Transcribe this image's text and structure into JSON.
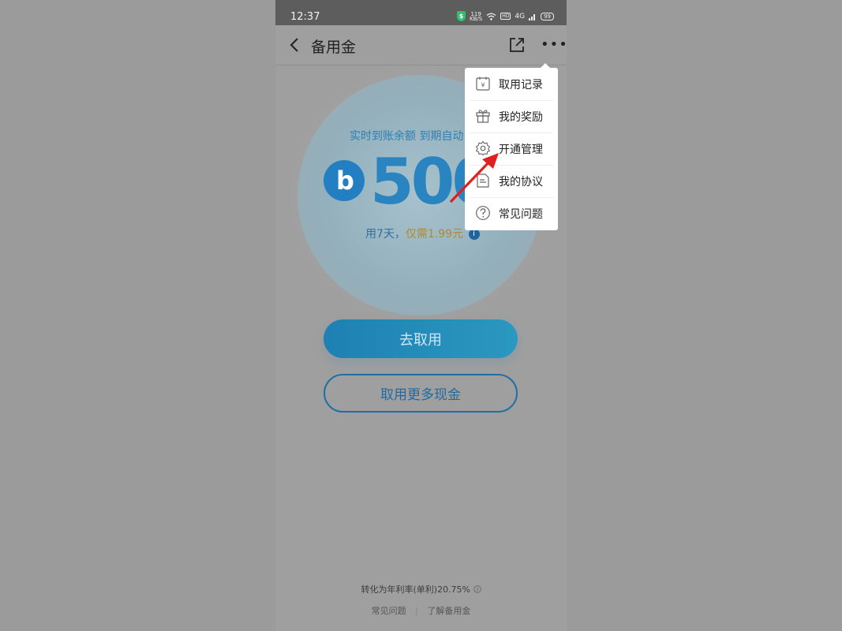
{
  "status_bar": {
    "time": "12:37",
    "speed_value": "119",
    "speed_unit": "KB/S",
    "hd": "HD",
    "network": "4G",
    "battery": "99"
  },
  "header": {
    "title": "备用金",
    "back_icon": "chevron-left-icon",
    "share_icon": "share-icon",
    "more_icon": "more-icon"
  },
  "hero": {
    "subtitle": "实时到账余额 到期自动",
    "amount": "500",
    "coin_letter": "b",
    "desc_days": "用7天，",
    "desc_price": "仅需1.99元",
    "info_icon": "i"
  },
  "buttons": {
    "primary": "去取用",
    "secondary": "取用更多现金"
  },
  "footer": {
    "rate_text": "转化为年利率(单利)20.75%",
    "link_faq": "常见问题",
    "separator": "|",
    "link_about": "了解备用金"
  },
  "menu": {
    "items": [
      {
        "label": "取用记录",
        "icon": "calendar-yen-icon"
      },
      {
        "label": "我的奖励",
        "icon": "gift-icon"
      },
      {
        "label": "开通管理",
        "icon": "gear-icon"
      },
      {
        "label": "我的协议",
        "icon": "document-icon"
      },
      {
        "label": "常见问题",
        "icon": "question-icon"
      }
    ]
  },
  "colors": {
    "accent_blue": "#2a84c0",
    "price_gold": "#b38a2a",
    "annotation_red": "#e02020"
  }
}
